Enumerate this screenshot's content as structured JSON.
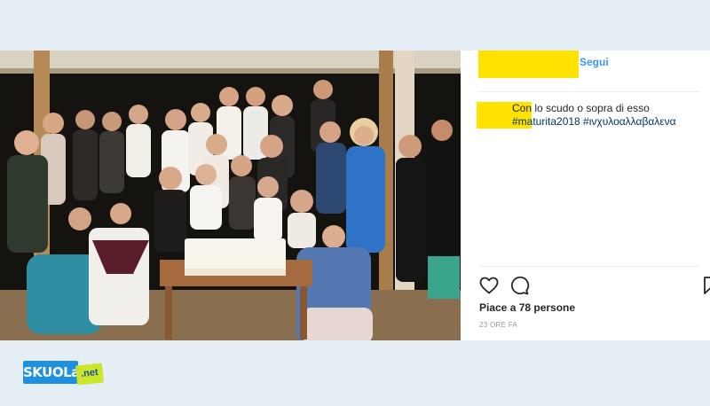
{
  "post": {
    "photo_alt": "",
    "follow_label": "Segui",
    "caption_text": "Con lo scudo o sopra di esso",
    "hashtags": "#maturita2018 #ινχυλοαλλαβαλενα",
    "likes": "Piace a 78 persone",
    "timestamp": "23 ORE FA",
    "cake_text": ""
  },
  "icons": {
    "like": "heart-icon",
    "comment": "comment-icon",
    "save": "bookmark-icon"
  },
  "logo": {
    "main": "SKUOLa",
    "suffix": ".net"
  },
  "colors": {
    "background": "#e5eef5",
    "highlight": "#ffe200",
    "link": "#3897f0",
    "hashtag": "#003569",
    "logo_blue": "#1e90e0",
    "logo_green": "#c9e62a"
  }
}
